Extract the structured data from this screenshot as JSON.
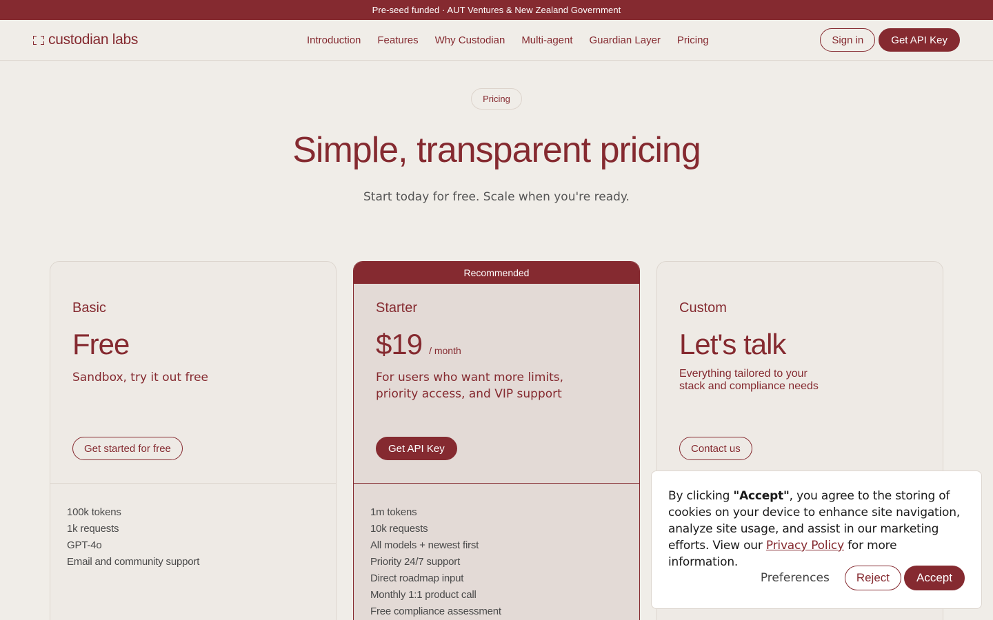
{
  "announcement": "Pre-seed funded · AUT Ventures & New Zealand Government",
  "logo": {
    "text": "custodian labs"
  },
  "nav": {
    "links": [
      "Introduction",
      "Features",
      "Why Custodian",
      "Multi-agent",
      "Guardian Layer",
      "Pricing"
    ],
    "sign_in": "Sign in",
    "get_api_key": "Get API Key"
  },
  "hero": {
    "pill": "Pricing",
    "title": "Simple, transparent pricing",
    "subtitle": "Start today for free. Scale when you're ready."
  },
  "plans": [
    {
      "name": "Basic",
      "price": "Free",
      "per": "",
      "description": "Sandbox, try it out free",
      "cta": "Get started for free",
      "features": [
        "100k tokens",
        "1k requests",
        "GPT-4o",
        "Email and community support"
      ]
    },
    {
      "badge": "Recommended",
      "name": "Starter",
      "price": "$19",
      "per": "/ month",
      "description": "For users who want more limits, priority access, and VIP support",
      "cta": "Get API Key",
      "features": [
        "1m tokens",
        "10k requests",
        "All models + newest first",
        "Priority 24/7 support",
        "Direct roadmap input",
        "Monthly 1:1 product call",
        "Free compliance assessment"
      ]
    },
    {
      "name": "Custom",
      "price": "Let's talk",
      "per": "",
      "description": "Everything tailored to your stack and compliance needs",
      "cta": "Contact us",
      "features": []
    }
  ],
  "cookie": {
    "prefix": "By clicking ",
    "accept_quote": "\"Accept\"",
    "body": ", you agree to the storing of cookies on your device to enhance site navigation, analyze site usage, and assist in our marketing efforts. View our ",
    "policy_link": "Privacy Policy",
    "suffix": " for more information.",
    "preferences": "Preferences",
    "reject": "Reject",
    "accept": "Accept"
  },
  "colors": {
    "brand": "#852a30",
    "background": "#f0ede8"
  }
}
